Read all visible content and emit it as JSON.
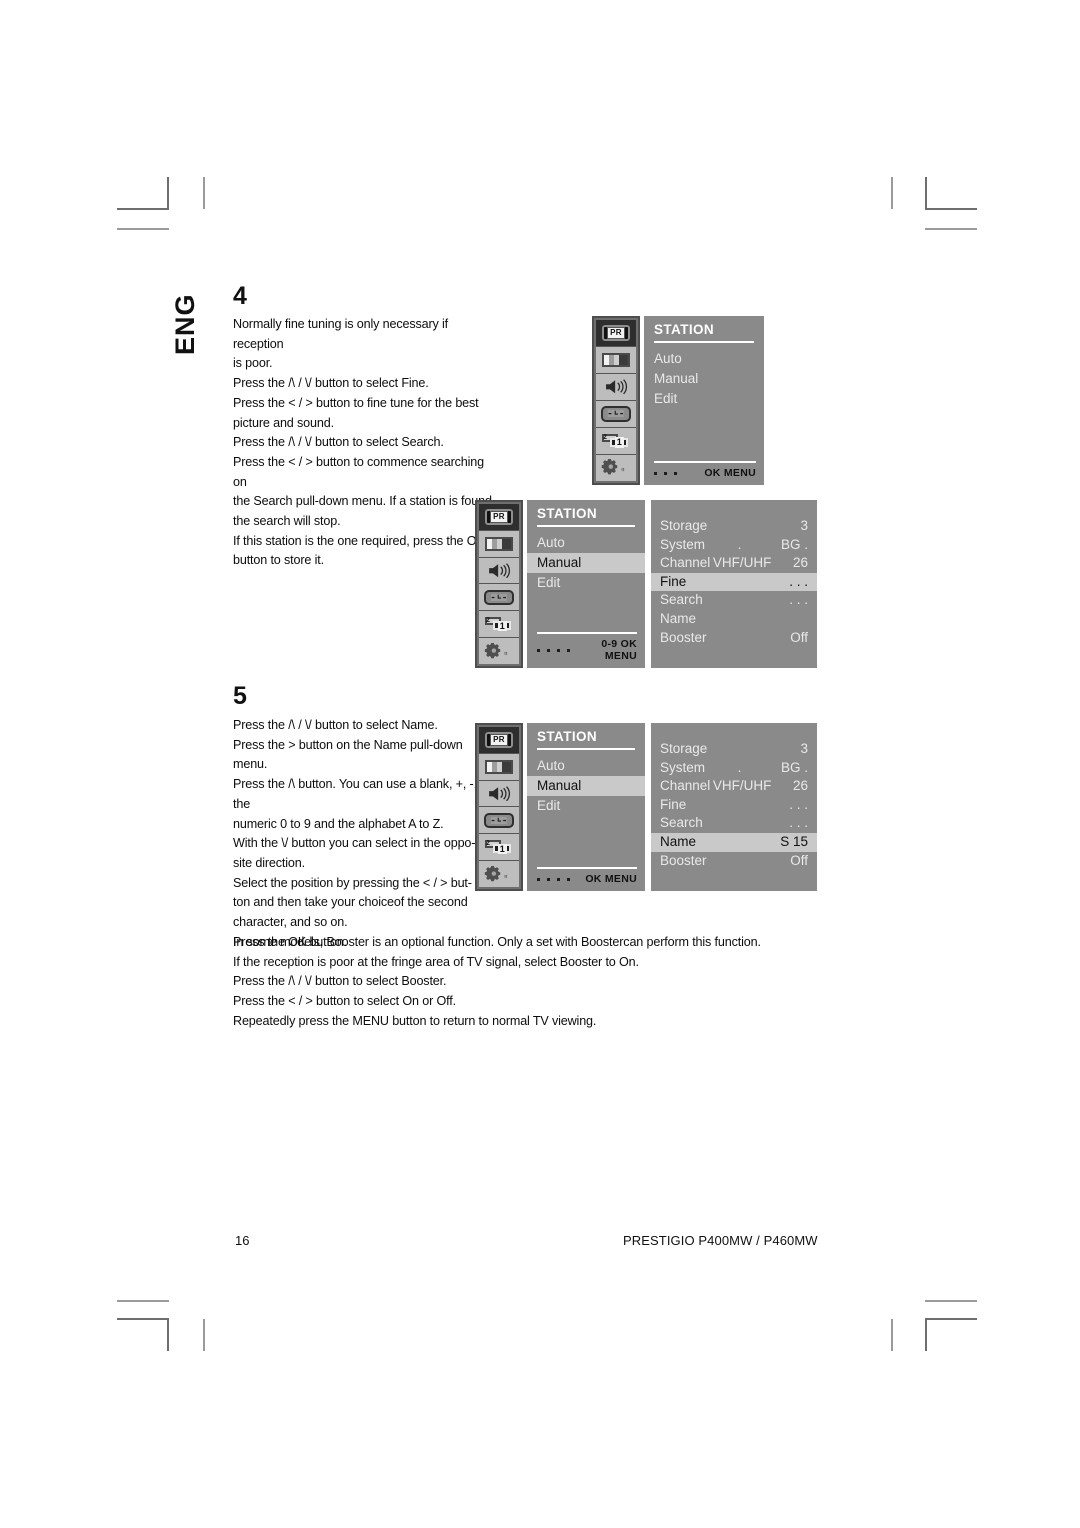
{
  "page": {
    "language_tab": "ENG",
    "page_number": "16",
    "footer_model": "PRESTIGIO P400MW / P460MW"
  },
  "steps": [
    {
      "number": "4",
      "text": "Normally fine tuning is only necessary if reception\nis poor.\nPress the /\\ / \\/ button to select Fine.\nPress the < / > button to fine tune for the best\npicture and sound.\nPress the /\\ / \\/ button to select Search.\nPress the < / > button to commence searching on\nthe Search pull-down menu. If a station is found\nthe search will stop.\nIf this station is the one required, press the OK\nbutton to store it."
    },
    {
      "number": "5",
      "text": "Press the /\\ / \\/ button to select Name.\nPress the  >  button on the Name pull-down\nmenu.\nPress the /\\ button. You can use a blank, +, -, the\nnumeric 0 to 9 and the alphabet A to Z.\nWith the \\/ button you can select in the oppo-\nsite direction.\nSelect the position by pressing the < / > but-\nton and then take your choiceof the second\ncharacter, and so on.\nPress the OK button."
    }
  ],
  "closing_text": "In some models, Booster is an optional function. Only a set with Boostercan perform this function.\nIf the reception is poor at the fringe area of TV signal, select Booster to On.\nPress the /\\ / \\/ button to select Booster.\nPress the < / > button to select On or Off.\nRepeatedly press the MENU button to return to normal TV viewing.",
  "icon_rail": [
    {
      "name": "station-pr-icon",
      "label": "PR"
    },
    {
      "name": "picture-icon",
      "label": ""
    },
    {
      "name": "sound-speaker-icon",
      "label": ""
    },
    {
      "name": "time-clock-icon",
      "label": ""
    },
    {
      "name": "pip-icon",
      "label": "1"
    },
    {
      "name": "setup-gear-icon",
      "label": ""
    }
  ],
  "osd": {
    "title": "STATION",
    "menu_items": [
      "Auto",
      "Manual",
      "Edit"
    ],
    "detail_rows": [
      {
        "label": "Storage",
        "mid": "",
        "value": "3"
      },
      {
        "label": "System",
        "mid": ".",
        "value": "BG ."
      },
      {
        "label": "Channel",
        "mid": "VHF/UHF",
        "value": "26"
      },
      {
        "label": "Fine",
        "mid": "",
        "value": ". . ."
      },
      {
        "label": "Search",
        "mid": "",
        "value": ". . ."
      },
      {
        "label": "Name",
        "mid": "",
        "value": ""
      },
      {
        "label": "Booster",
        "mid": "",
        "value": "Off"
      }
    ],
    "detail_rows_name": [
      {
        "label": "Storage",
        "mid": "",
        "value": "3"
      },
      {
        "label": "System",
        "mid": ".",
        "value": "BG ."
      },
      {
        "label": "Channel",
        "mid": "VHF/UHF",
        "value": "26"
      },
      {
        "label": "Fine",
        "mid": "",
        "value": ". . ."
      },
      {
        "label": "Search",
        "mid": "",
        "value": ". . ."
      },
      {
        "label": "Name",
        "mid": "",
        "value": "S  15"
      },
      {
        "label": "Booster",
        "mid": "",
        "value": "Off"
      }
    ],
    "footer_keys_ok_menu": "OK  MENU",
    "footer_keys_num_ok_menu": "0-9 OK MENU"
  },
  "colors": {
    "osd_panel": "#8a8a8a",
    "osd_highlight": "#c9c9c9",
    "osd_rail_bg": "#6f6f6f",
    "osd_text": "#e9e9e9",
    "crop_mark": "#6e6e6e"
  }
}
